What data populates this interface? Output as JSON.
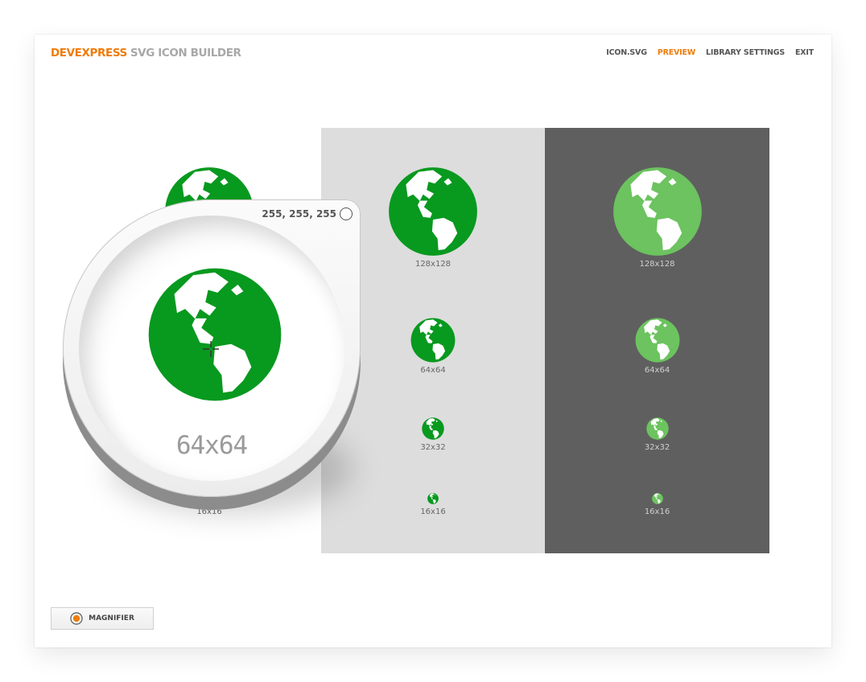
{
  "app": {
    "brand_primary": "DEVEXPRESS",
    "brand_secondary": "SVG ICON BUILDER"
  },
  "nav": {
    "icon_svg": "ICON.SVG",
    "preview": "PREVIEW",
    "library_settings": "LIBRARY SETTINGS",
    "exit": "EXIT"
  },
  "colors": {
    "accent": "#ee7c0c",
    "icon_green": "#08991f",
    "icon_green_light": "#6cc35f",
    "panel_light": "#dddddd",
    "panel_dark": "#5f5f5f"
  },
  "preview": {
    "icon_name": "globe-icon",
    "sizes": [
      "128x128",
      "64x64",
      "32x32",
      "16x16"
    ]
  },
  "magnifier": {
    "rgb_readout": "255, 255, 255",
    "zoom_label": "64x64",
    "swatch_color": "#ffffff"
  },
  "footer": {
    "magnifier_button": "MAGNIFIER"
  }
}
